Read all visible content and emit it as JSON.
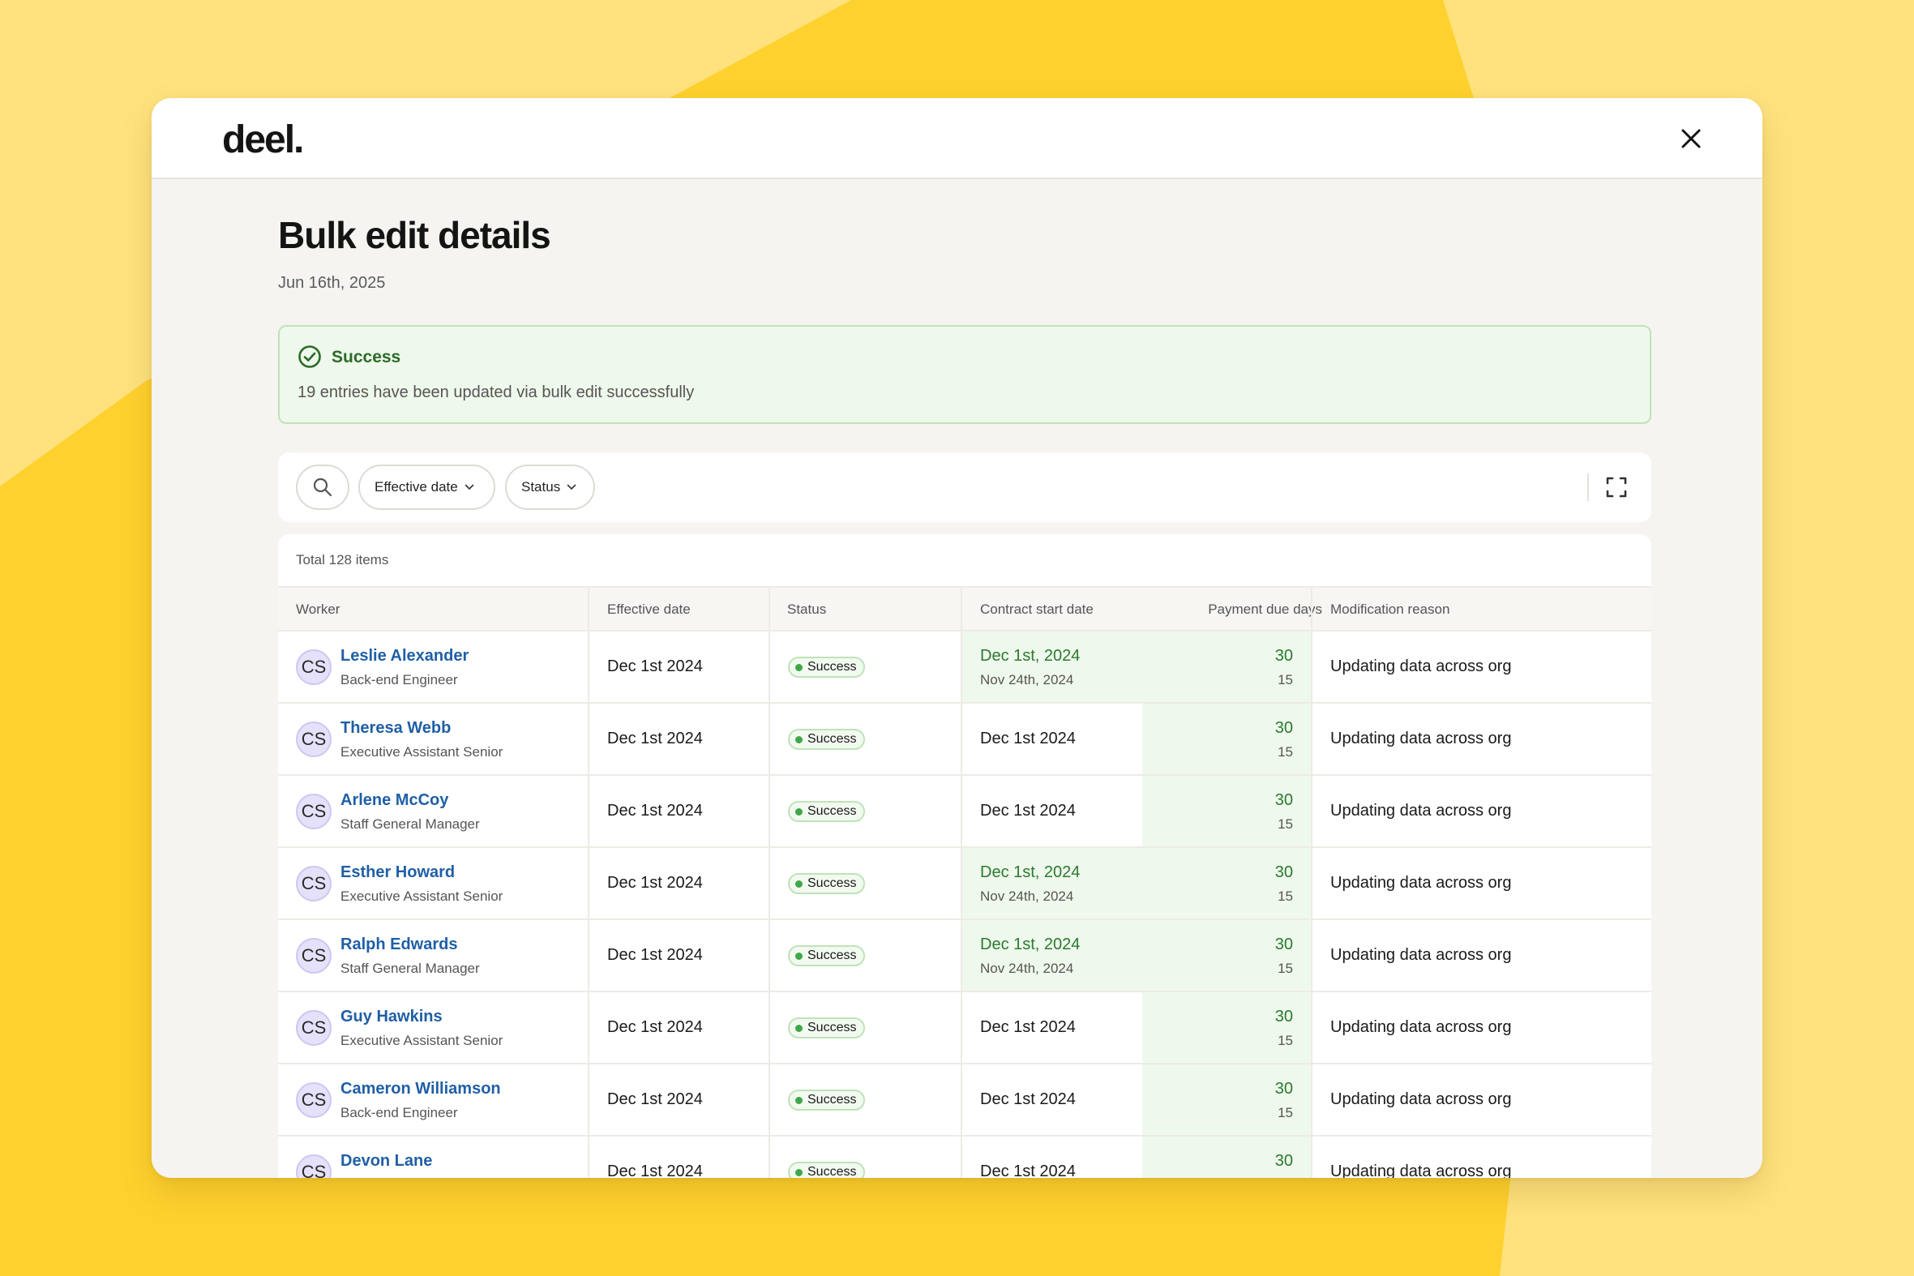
{
  "brand": {
    "logo_text": "deel."
  },
  "header": {
    "title": "Bulk edit details",
    "date": "Jun 16th, 2025"
  },
  "alert": {
    "title": "Success",
    "message": "19 entries have been updated via bulk edit successfully",
    "icon": "check-circle-icon",
    "color": "#2A6B27"
  },
  "toolbar": {
    "filters": [
      {
        "label": "Effective date"
      },
      {
        "label": "Status"
      }
    ]
  },
  "table": {
    "total_label": "Total 128 items",
    "columns": [
      "Worker",
      "Effective date",
      "Status",
      "Contract start date",
      "Payment due days",
      "Modification reason"
    ],
    "rows": [
      {
        "initials": "CS",
        "name": "Leslie Alexander",
        "role": "Back-end Engineer",
        "effective": "Dec 1st 2024",
        "status": "Success",
        "contract_new": "Dec 1st, 2024",
        "contract_old": "Nov 24th, 2024",
        "contract_changed": true,
        "pay_new": "30",
        "pay_old": "15",
        "reason": "Updating data across org"
      },
      {
        "initials": "CS",
        "name": "Theresa Webb",
        "role": "Executive Assistant Senior",
        "effective": "Dec 1st 2024",
        "status": "Success",
        "contract_new": "Dec 1st 2024",
        "contract_old": "",
        "contract_changed": false,
        "pay_new": "30",
        "pay_old": "15",
        "reason": "Updating data across org"
      },
      {
        "initials": "CS",
        "name": "Arlene McCoy",
        "role": "Staff General Manager",
        "effective": "Dec 1st 2024",
        "status": "Success",
        "contract_new": "Dec 1st 2024",
        "contract_old": "",
        "contract_changed": false,
        "pay_new": "30",
        "pay_old": "15",
        "reason": "Updating data across org"
      },
      {
        "initials": "CS",
        "name": "Esther Howard",
        "role": "Executive Assistant Senior",
        "effective": "Dec 1st 2024",
        "status": "Success",
        "contract_new": "Dec 1st, 2024",
        "contract_old": "Nov 24th, 2024",
        "contract_changed": true,
        "pay_new": "30",
        "pay_old": "15",
        "reason": "Updating data across org"
      },
      {
        "initials": "CS",
        "name": "Ralph Edwards",
        "role": "Staff General Manager",
        "effective": "Dec 1st 2024",
        "status": "Success",
        "contract_new": "Dec 1st, 2024",
        "contract_old": "Nov 24th, 2024",
        "contract_changed": true,
        "pay_new": "30",
        "pay_old": "15",
        "reason": "Updating data across org"
      },
      {
        "initials": "CS",
        "name": "Guy Hawkins",
        "role": "Executive Assistant Senior",
        "effective": "Dec 1st 2024",
        "status": "Success",
        "contract_new": "Dec 1st 2024",
        "contract_old": "",
        "contract_changed": false,
        "pay_new": "30",
        "pay_old": "15",
        "reason": "Updating data across org"
      },
      {
        "initials": "CS",
        "name": "Cameron Williamson",
        "role": "Back-end Engineer",
        "effective": "Dec 1st 2024",
        "status": "Success",
        "contract_new": "Dec 1st 2024",
        "contract_old": "",
        "contract_changed": false,
        "pay_new": "30",
        "pay_old": "15",
        "reason": "Updating data across org"
      },
      {
        "initials": "CS",
        "name": "Devon Lane",
        "role": "",
        "effective": "Dec 1st 2024",
        "status": "Success",
        "contract_new": "Dec 1st 2024",
        "contract_old": "",
        "contract_changed": false,
        "pay_new": "30",
        "pay_old": "",
        "reason": "Updating data across org"
      }
    ]
  },
  "colors": {
    "background": "#FFD12E",
    "link": "#1F5FA6",
    "success": "#3FA64A",
    "highlight": "#EFF8EC"
  }
}
